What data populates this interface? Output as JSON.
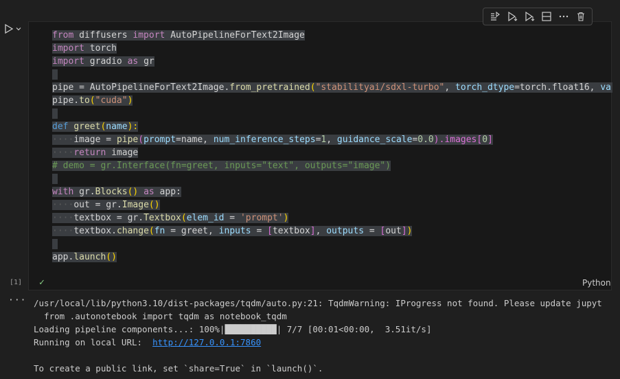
{
  "toolbar": {
    "icons": [
      "run-by-line-icon",
      "execute-above-icon",
      "execute-below-icon",
      "split-cell-icon",
      "more-icon",
      "delete-icon"
    ]
  },
  "cell": {
    "execution_count": "[1]",
    "status_icon": "✓",
    "language": "Python",
    "code": {
      "l1": {
        "a": "from",
        "b": " diffusers ",
        "c": "import",
        "d": " AutoPipelineForText2Image"
      },
      "l2": {
        "a": "import",
        "b": " torch"
      },
      "l3": {
        "a": "import",
        "b": " gradio ",
        "c": "as",
        "d": " gr"
      },
      "l5": {
        "a": "pipe = AutoPipelineForText2Image.",
        "b": "from_pretrained",
        "c": "(",
        "d": "\"stabilityai/sdxl-turbo\"",
        "e": ", ",
        "f": "torch_dtype",
        "g": "=torch.float16, ",
        "h": "vari"
      },
      "l6": {
        "a": "pipe.",
        "b": "to",
        "c": "(",
        "d": "\"cuda\"",
        "e": ")"
      },
      "l8": {
        "a": "def",
        "b": " ",
        "c": "greet",
        "d": "(",
        "e": "name",
        "f": "):"
      },
      "l9": {
        "ws": "····",
        "a": "image = ",
        "b": "pipe",
        "c": "(",
        "d": "prompt",
        "e": "=name, ",
        "f": "num_inference_steps",
        "g": "=",
        "h": "1",
        "i": ", ",
        "j": "guidance_scale",
        "k": "=",
        "l": "0.0",
        "m": ").images",
        "n": "[",
        "o": "0",
        "p": "]"
      },
      "l10": {
        "ws": "····",
        "a": "return",
        "b": " image"
      },
      "l11": {
        "a": "# demo = gr.Interface(fn=greet, inputs=\"text\", outputs=\"image\")"
      },
      "l13": {
        "a": "with",
        "b": " gr.",
        "c": "Blocks",
        "d": "()",
        "e": " ",
        "f": "as",
        "g": " app:"
      },
      "l14": {
        "ws": "····",
        "a": "out = gr.",
        "b": "Image",
        "c": "()"
      },
      "l15": {
        "ws": "····",
        "a": "textbox = gr.",
        "b": "Textbox",
        "c": "(",
        "d": "elem_id",
        "e": " = ",
        "f": "'prompt'",
        "g": ")"
      },
      "l16": {
        "ws": "····",
        "a": "textbox.",
        "b": "change",
        "c": "(",
        "d": "fn",
        "e": " = greet, ",
        "f": "inputs",
        "g": " = ",
        "h": "[",
        "i": "textbox",
        "j": "]",
        "k": ", ",
        "l": "outputs",
        "m": " = ",
        "n": "[",
        "o": "out",
        "p": "]",
        "q": ")"
      },
      "l18": {
        "a": "app.",
        "b": "launch",
        "c": "()"
      }
    }
  },
  "output": {
    "ellipsis": "···",
    "lines": [
      "/usr/local/lib/python3.10/dist-packages/tqdm/auto.py:21: TqdmWarning: IProgress not found. Please update jupyt",
      "  from .autonotebook import tqdm as notebook_tqdm",
      "Loading pipeline components...: 100%|██████████| 7/7 [00:01<00:00,  3.51it/s]"
    ],
    "url_prefix": "Running on local URL:  ",
    "url": "http://127.0.0.1:7860",
    "share_line": "To create a public link, set `share=True` in `launch()`."
  }
}
